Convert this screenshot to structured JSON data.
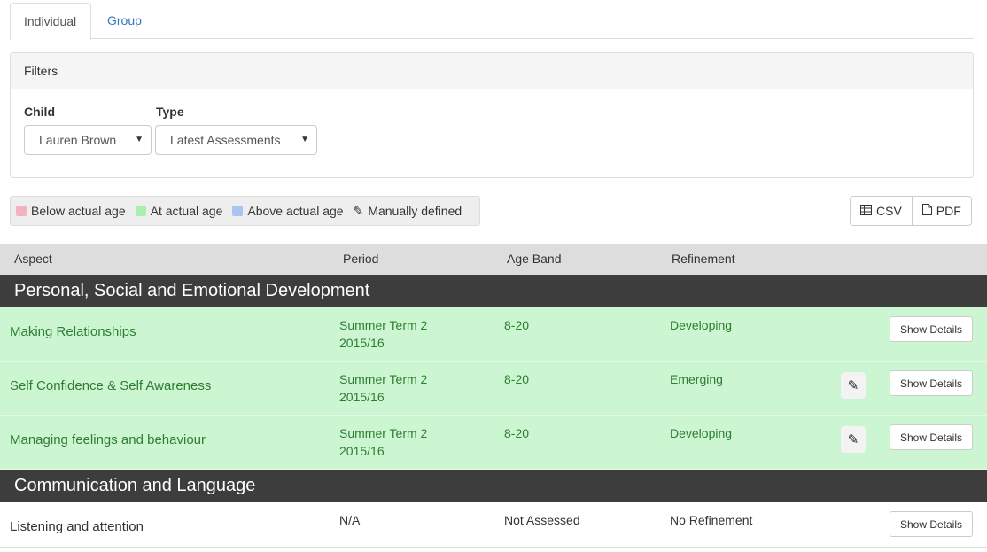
{
  "tabs": [
    {
      "label": "Individual",
      "active": true
    },
    {
      "label": "Group",
      "active": false
    }
  ],
  "filters": {
    "heading": "Filters",
    "child": {
      "label": "Child",
      "value": "Lauren Brown"
    },
    "type": {
      "label": "Type",
      "value": "Latest Assessments"
    }
  },
  "legend": [
    {
      "label": "Below actual age",
      "color": "#f0b3c2"
    },
    {
      "label": "At actual age",
      "color": "#a8f0b0"
    },
    {
      "label": "Above actual age",
      "color": "#a9c4f0"
    },
    {
      "label": "Manually defined",
      "icon": "pencil-icon"
    }
  ],
  "export": {
    "csv_label": "CSV",
    "pdf_label": "PDF"
  },
  "table": {
    "headers": {
      "aspect": "Aspect",
      "period": "Period",
      "age_band": "Age Band",
      "refinement": "Refinement"
    },
    "groups": [
      {
        "title": "Personal, Social and Emotional Development",
        "rows": [
          {
            "aspect": "Making Relationships",
            "period_1": "Summer Term 2",
            "period_2": "2015/16",
            "age_band": "8-20",
            "refinement": "Developing",
            "manual": false,
            "details_label": "Show Details"
          },
          {
            "aspect": "Self Confidence & Self Awareness",
            "period_1": "Summer Term 2",
            "period_2": "2015/16",
            "age_band": "8-20",
            "refinement": "Emerging",
            "manual": true,
            "details_label": "Show Details"
          },
          {
            "aspect": "Managing feelings and behaviour",
            "period_1": "Summer Term 2",
            "period_2": "2015/16",
            "age_band": "8-20",
            "refinement": "Developing",
            "manual": true,
            "details_label": "Show Details"
          }
        ]
      },
      {
        "title": "Communication and Language",
        "rows": [
          {
            "aspect": "Listening and attention",
            "period_1": "N/A",
            "age_band": "Not Assessed",
            "refinement": "No Refinement",
            "manual": false,
            "details_label": "Show Details"
          }
        ]
      }
    ]
  },
  "colors": {
    "at_actual_age_row": "#ccf5d1",
    "group_header": "#3d3d3d",
    "link": "#337ab7"
  }
}
